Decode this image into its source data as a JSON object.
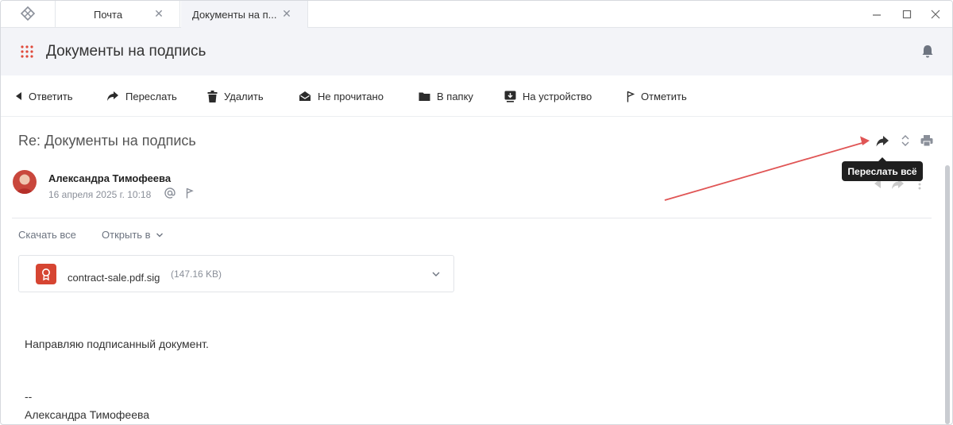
{
  "tabs": [
    {
      "label": "Почта"
    },
    {
      "label": "Документы на п..."
    }
  ],
  "header": {
    "title": "Документы на подпись"
  },
  "toolbar": {
    "reply": "Ответить",
    "forward": "Переслать",
    "delete": "Удалить",
    "unread": "Не прочитано",
    "to_folder": "В папку",
    "to_device": "На устройство",
    "mark": "Отметить"
  },
  "message": {
    "subject": "Re: Документы на подпись",
    "sender": "Александра Тимофеева",
    "date": "16 апреля 2025 г. 10:18",
    "download_all": "Скачать все",
    "open_in": "Открыть в",
    "attachment": {
      "name": "contract-sale.pdf.sig",
      "size": "(147.16 KB)"
    },
    "body": "Направляю подписанный документ.",
    "signature_dash": "--",
    "signature_name": "Александра Тимофеева"
  },
  "tooltip": {
    "text": "Переслать всё"
  },
  "colors": {
    "accent_red": "#d64532",
    "annotation_arrow": "#e05555",
    "tooltip_bg": "#1f1f1f"
  }
}
